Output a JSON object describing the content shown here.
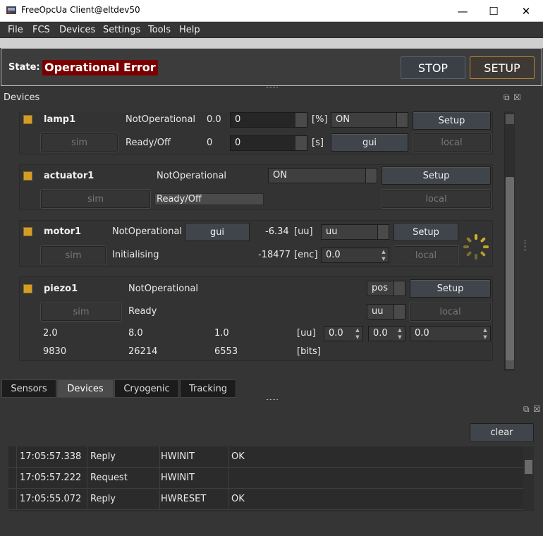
{
  "window": {
    "title": "FreeOpcUa Client@eltdev50",
    "minimize_icon": "—",
    "maximize_icon": "☐",
    "close_icon": "✕"
  },
  "menu": [
    "File",
    "FCS",
    "Devices",
    "Settings",
    "Tools",
    "Help"
  ],
  "state": {
    "label": "State:",
    "value1": "Operational",
    "value2": "Error",
    "stop_label": "STOP",
    "setup_label": "SETUP"
  },
  "dock": {
    "title": "Devices",
    "float_icon": "⧉",
    "close_icon": "☒"
  },
  "lamp1": {
    "name": "lamp1",
    "status": "NotOperational",
    "value": "0.0",
    "input": "0",
    "unit": "[%]",
    "mode": "ON",
    "setup": "Setup",
    "sim": "sim",
    "substate": "Ready/Off",
    "value2": "0",
    "input2": "0",
    "unit2": "[s]",
    "gui": "gui",
    "local": "local"
  },
  "actuator1": {
    "name": "actuator1",
    "status": "NotOperational",
    "mode": "ON",
    "setup": "Setup",
    "sim": "sim",
    "substate": "Ready/Off",
    "local": "local"
  },
  "motor1": {
    "name": "motor1",
    "status": "NotOperational",
    "gui": "gui",
    "value": "-6.34",
    "unit": "[uu]",
    "mode": "uu",
    "setup": "Setup",
    "sim": "sim",
    "substate": "Initialising",
    "enc_value": "-18477",
    "enc_unit": "[enc]",
    "input": "0.0",
    "local": "local"
  },
  "piezo1": {
    "name": "piezo1",
    "status": "NotOperational",
    "mode": "pos",
    "setup": "Setup",
    "sim": "sim",
    "substate": "Ready",
    "mode2": "uu",
    "local": "local",
    "row1": [
      "2.0",
      "8.0",
      "1.0"
    ],
    "unit1": "[uu]",
    "inputs": [
      "0.0",
      "0.0",
      "0.0"
    ],
    "row2": [
      "9830",
      "26214",
      "6553"
    ],
    "unit2": "[bits]"
  },
  "tabs": [
    "Sensors",
    "Devices",
    "Cryogenic",
    "Tracking"
  ],
  "active_tab": "Devices",
  "log": {
    "clear_label": "clear",
    "rows": [
      {
        "time": "17:05:57.338",
        "type": "Reply",
        "command": "HWINIT",
        "result": "OK"
      },
      {
        "time": "17:05:57.222",
        "type": "Request",
        "command": "HWINIT",
        "result": ""
      },
      {
        "time": "17:05:55.072",
        "type": "Reply",
        "command": "HWRESET",
        "result": "OK"
      }
    ]
  },
  "colors": {
    "accent": "#d39e27",
    "error": "#7a0000",
    "setup_border": "#b9853b"
  }
}
